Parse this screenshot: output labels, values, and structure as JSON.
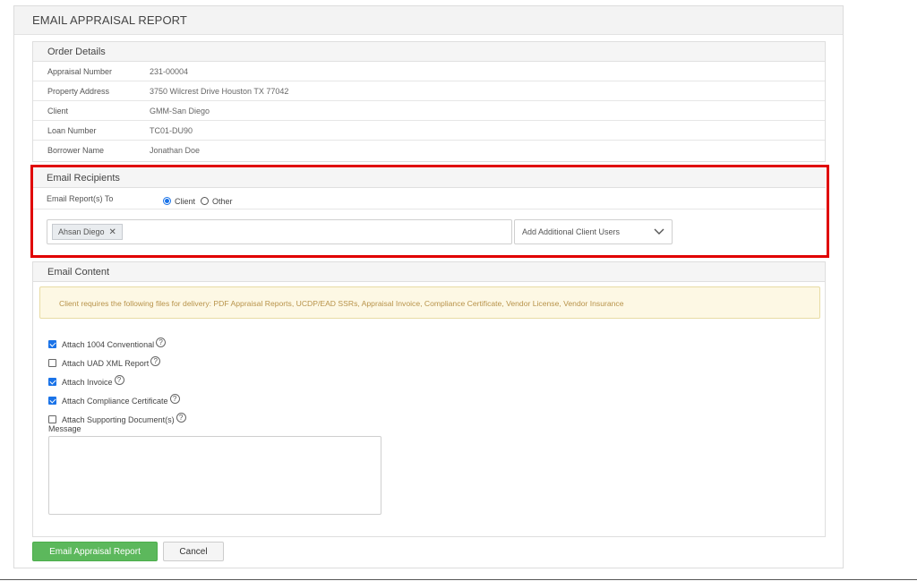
{
  "panel": {
    "title": "EMAIL APPRAISAL REPORT"
  },
  "order_details": {
    "title": "Order Details",
    "rows": [
      {
        "label": "Appraisal Number",
        "value": "231-00004"
      },
      {
        "label": "Property Address",
        "value": "3750 Wilcrest Drive Houston TX 77042"
      },
      {
        "label": "Client",
        "value": "GMM-San Diego"
      },
      {
        "label": "Loan Number",
        "value": "TC01-DU90"
      },
      {
        "label": "Borrower Name",
        "value": "Jonathan Doe"
      }
    ]
  },
  "recipients": {
    "title": "Email Recipients",
    "label": "Email Report(s) To",
    "options": [
      {
        "label": "Client",
        "selected": true
      },
      {
        "label": "Other",
        "selected": false
      }
    ],
    "tags": [
      "Ahsan Diego"
    ],
    "tag_remove_symbol": "✕",
    "dropdown_placeholder": "Add Additional Client Users",
    "highlight_color": "#e00000"
  },
  "email_content": {
    "title": "Email Content",
    "notice": "Client requires the following files for delivery: PDF Appraisal Reports, UCDP/EAD SSRs, Appraisal Invoice, Compliance Certificate, Vendor License, Vendor Insurance",
    "attachments": [
      {
        "label": "Attach 1004 Conventional",
        "checked": true
      },
      {
        "label": "Attach UAD XML Report",
        "checked": false
      },
      {
        "label": "Attach Invoice",
        "checked": true
      },
      {
        "label": "Attach Compliance Certificate",
        "checked": true
      },
      {
        "label": "Attach Supporting Document(s)",
        "checked": false
      }
    ],
    "help_symbol": "?",
    "message_label": "Message",
    "message_value": ""
  },
  "actions": {
    "submit_label": "Email Appraisal Report",
    "cancel_label": "Cancel"
  },
  "colors": {
    "primary_green": "#5cb85c",
    "accent_blue": "#1a73e8",
    "notice_text": "#b8934a"
  }
}
